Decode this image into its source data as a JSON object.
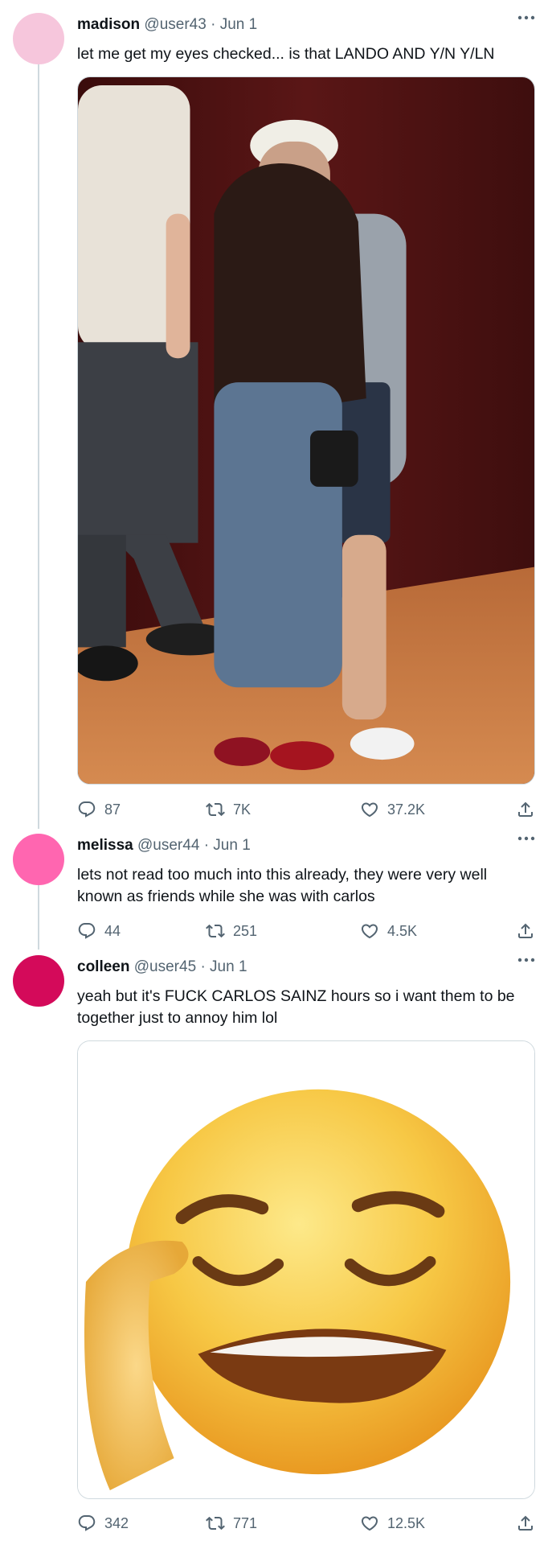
{
  "colors": {
    "avatar_1": "#f6c6dc",
    "avatar_2": "#ff66b0",
    "avatar_3": "#d40a5a"
  },
  "tweets": [
    {
      "name": "madison",
      "handle": "@user43",
      "separator": "·",
      "date": "Jun 1",
      "text": "let me get my eyes checked... is that LANDO AND Y/N Y/LN",
      "replies": "87",
      "retweets": "7K",
      "likes": "37.2K"
    },
    {
      "name": "melissa",
      "handle": "@user44",
      "separator": "·",
      "date": "Jun 1",
      "text": "lets not read too much into this already, they were very well known as friends while she was with carlos",
      "replies": "44",
      "retweets": "251",
      "likes": "4.5K"
    },
    {
      "name": "colleen",
      "handle": "@user45",
      "separator": "·",
      "date": "Jun 1",
      "text": "yeah but it's FUCK CARLOS SAINZ hours so i want them to be together just to annoy him lol",
      "replies": "342",
      "retweets": "771",
      "likes": "12.5K"
    }
  ],
  "icons": {
    "more": "more-dots-icon",
    "reply": "reply-icon",
    "retweet": "retweet-icon",
    "like": "heart-icon",
    "share": "share-icon"
  }
}
